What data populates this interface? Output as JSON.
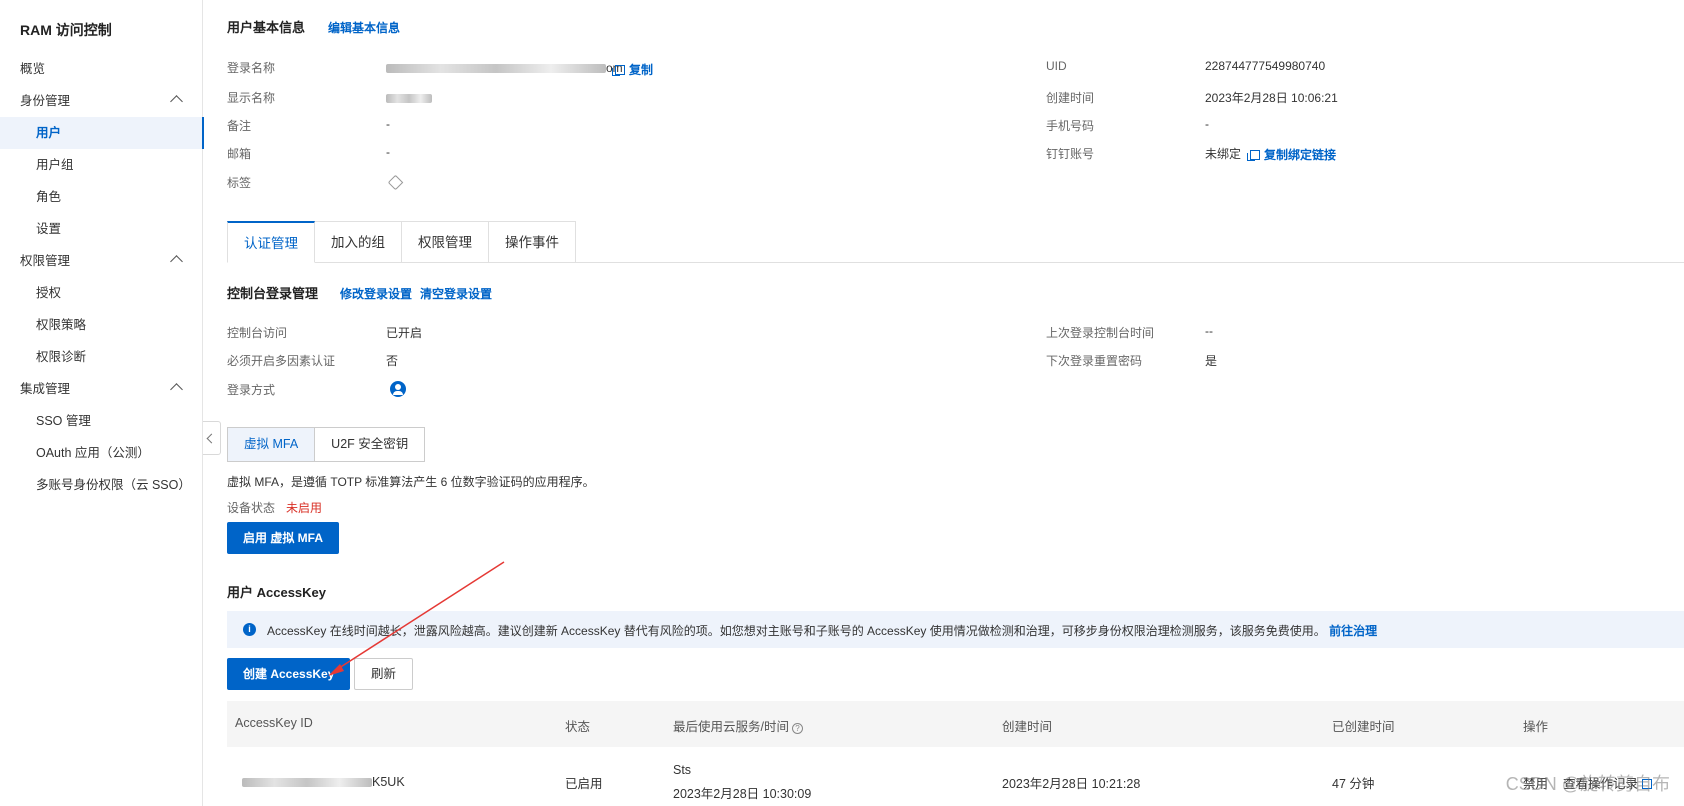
{
  "sidebar": {
    "title": "RAM 访问控制",
    "overview": "概览",
    "groups": [
      {
        "label": "身份管理",
        "items": [
          "用户",
          "用户组",
          "角色",
          "设置"
        ]
      },
      {
        "label": "权限管理",
        "items": [
          "授权",
          "权限策略",
          "权限诊断"
        ]
      },
      {
        "label": "集成管理",
        "items": [
          "SSO 管理",
          "OAuth 应用（公测）",
          "多账号身份权限（云 SSO）"
        ]
      }
    ],
    "active_item": "用户"
  },
  "basic_info": {
    "title": "用户基本信息",
    "edit_link": "编辑基本信息",
    "login_name_label": "登录名称",
    "login_name_suffix": "om",
    "copy_label": "复制",
    "display_name_label": "显示名称",
    "remark_label": "备注",
    "remark_value": "-",
    "email_label": "邮箱",
    "email_value": "-",
    "tags_label": "标签",
    "uid_label": "UID",
    "uid_value": "228744777549980740",
    "created_label": "创建时间",
    "created_value": "2023年2月28日 10:06:21",
    "phone_label": "手机号码",
    "phone_value": "-",
    "dingtalk_label": "钉钉账号",
    "dingtalk_value": "未绑定",
    "copy_bind_link": "复制绑定链接"
  },
  "tabs": [
    "认证管理",
    "加入的组",
    "权限管理",
    "操作事件"
  ],
  "console_login": {
    "title": "控制台登录管理",
    "modify_link": "修改登录设置",
    "clear_link": "清空登录设置",
    "access_label": "控制台访问",
    "access_value": "已开启",
    "mfa_required_label": "必须开启多因素认证",
    "mfa_required_value": "否",
    "login_method_label": "登录方式",
    "last_login_label": "上次登录控制台时间",
    "last_login_value": "--",
    "reset_pwd_label": "下次登录重置密码",
    "reset_pwd_value": "是"
  },
  "mfa": {
    "tabs": [
      "虚拟 MFA",
      "U2F 安全密钥"
    ],
    "description": "虚拟 MFA，是遵循 TOTP 标准算法产生 6 位数字验证码的应用程序。",
    "status_label": "设备状态",
    "status_value": "未启用",
    "enable_button": "启用 虚拟 MFA"
  },
  "accesskey": {
    "title": "用户 AccessKey",
    "notice": "AccessKey 在线时间越长，泄露风险越高。建议创建新 AccessKey 替代有风险的项。如您想对主账号和子账号的 AccessKey 使用情况做检测和治理，可移步身份权限治理检测服务，该服务免费使用。",
    "notice_link": "前往治理",
    "create_button": "创建 AccessKey",
    "refresh_button": "刷新",
    "columns": [
      "AccessKey ID",
      "状态",
      "最后使用云服务/时间",
      "创建时间",
      "已创建时间",
      "操作"
    ],
    "rows": [
      {
        "id_suffix": "K5UK",
        "status": "已启用",
        "last_service": "Sts",
        "last_time": "2023年2月28日 10:30:09",
        "created": "2023年2月28日 10:21:28",
        "age": "47 分钟",
        "action_disable": "禁用",
        "action_log": "查看操作记录"
      }
    ]
  },
  "watermark": "CSDN @旋转剪自布",
  "colors": {
    "accent": "#0064c8",
    "danger": "#d93026",
    "arrow": "#e53935"
  }
}
